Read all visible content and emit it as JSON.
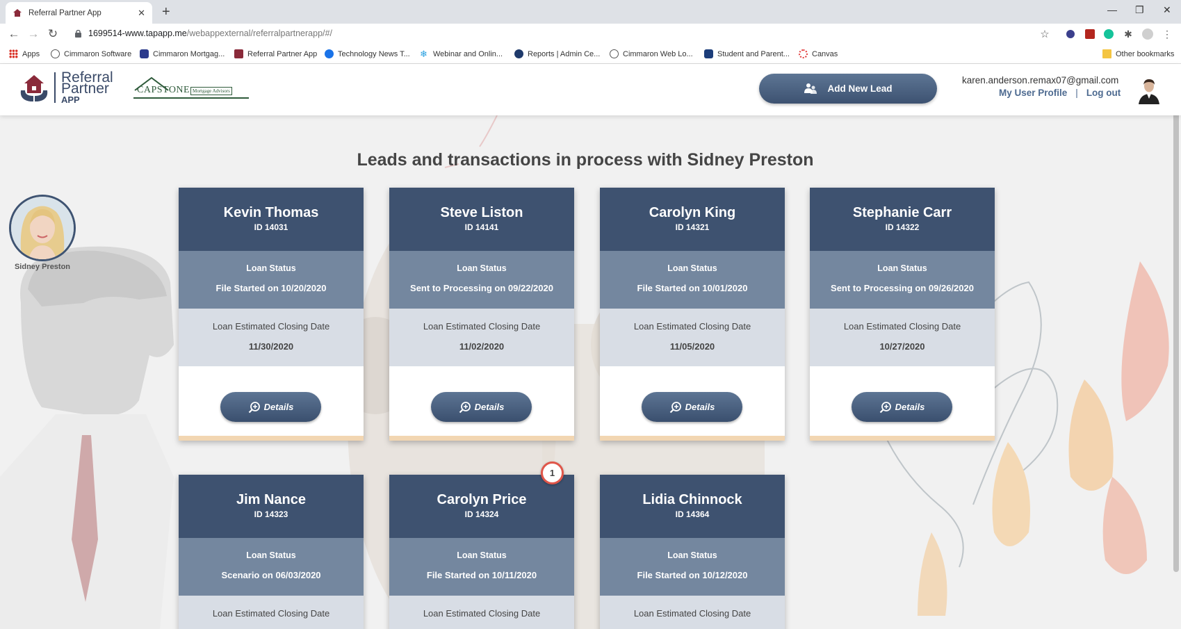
{
  "browser": {
    "tab_title": "Referral Partner App",
    "url_host": "1699514-www.tapapp.me",
    "url_path": "/webappexternal/referralpartnerapp/#/",
    "bookmarks": [
      {
        "label": "Apps",
        "color": "#d93025"
      },
      {
        "label": "Cimmaron Software",
        "color": "#555555"
      },
      {
        "label": "Cimmaron Mortgag...",
        "color": "#2b3a8c"
      },
      {
        "label": "Referral Partner App",
        "color": "#8a2a3a"
      },
      {
        "label": "Technology News T...",
        "color": "#1a73e8"
      },
      {
        "label": "Webinar and Onlin...",
        "color": "#29a0e0"
      },
      {
        "label": "Reports | Admin Ce...",
        "color": "#1f3a6b"
      },
      {
        "label": "Cimmaron Web Lo...",
        "color": "#555555"
      },
      {
        "label": "Student and Parent...",
        "color": "#1c3d7a"
      },
      {
        "label": "Canvas",
        "color": "#e23d3d"
      }
    ],
    "other_bookmarks": "Other bookmarks"
  },
  "header": {
    "logo_line1": "Referral",
    "logo_line2": "Partner",
    "logo_line3": "APP",
    "partner_logo": "CAPSTONE",
    "partner_logo_sub": "Mortgage Advisors",
    "add_lead_label": "Add New Lead",
    "user_email": "karen.anderson.remax07@gmail.com",
    "profile_link": "My User Profile",
    "separator": "|",
    "logout_link": "Log out"
  },
  "main": {
    "title": "Leads and transactions in process with Sidney Preston",
    "agent_name": "Sidney Preston",
    "status_label": "Loan Status",
    "closing_label": "Loan Estimated Closing Date",
    "details_label": "Details",
    "notification_count": "1",
    "leads": [
      {
        "name": "Kevin Thomas",
        "id": "ID 14031",
        "status": "File Started on 10/20/2020",
        "closing": "11/30/2020"
      },
      {
        "name": "Steve Liston",
        "id": "ID 14141",
        "status": "Sent to Processing on 09/22/2020",
        "closing": "11/02/2020"
      },
      {
        "name": "Carolyn King",
        "id": "ID 14321",
        "status": "File Started on 10/01/2020",
        "closing": "11/05/2020"
      },
      {
        "name": "Stephanie Carr",
        "id": "ID 14322",
        "status": "Sent to Processing on 09/26/2020",
        "closing": "10/27/2020"
      },
      {
        "name": "Jim Nance",
        "id": "ID 14323",
        "status": "Scenario on 06/03/2020",
        "closing": ""
      },
      {
        "name": "Carolyn Price",
        "id": "ID 14324",
        "status": "File Started on 10/11/2020",
        "closing": ""
      },
      {
        "name": "Lidia Chinnock",
        "id": "ID 14364",
        "status": "File Started on 10/12/2020",
        "closing": ""
      }
    ]
  },
  "colors": {
    "card_head": "#3e5270",
    "card_status": "#74879f",
    "card_closing": "#d8dde5",
    "accent_button": "#4d6585",
    "badge_ring": "#e0564a"
  }
}
